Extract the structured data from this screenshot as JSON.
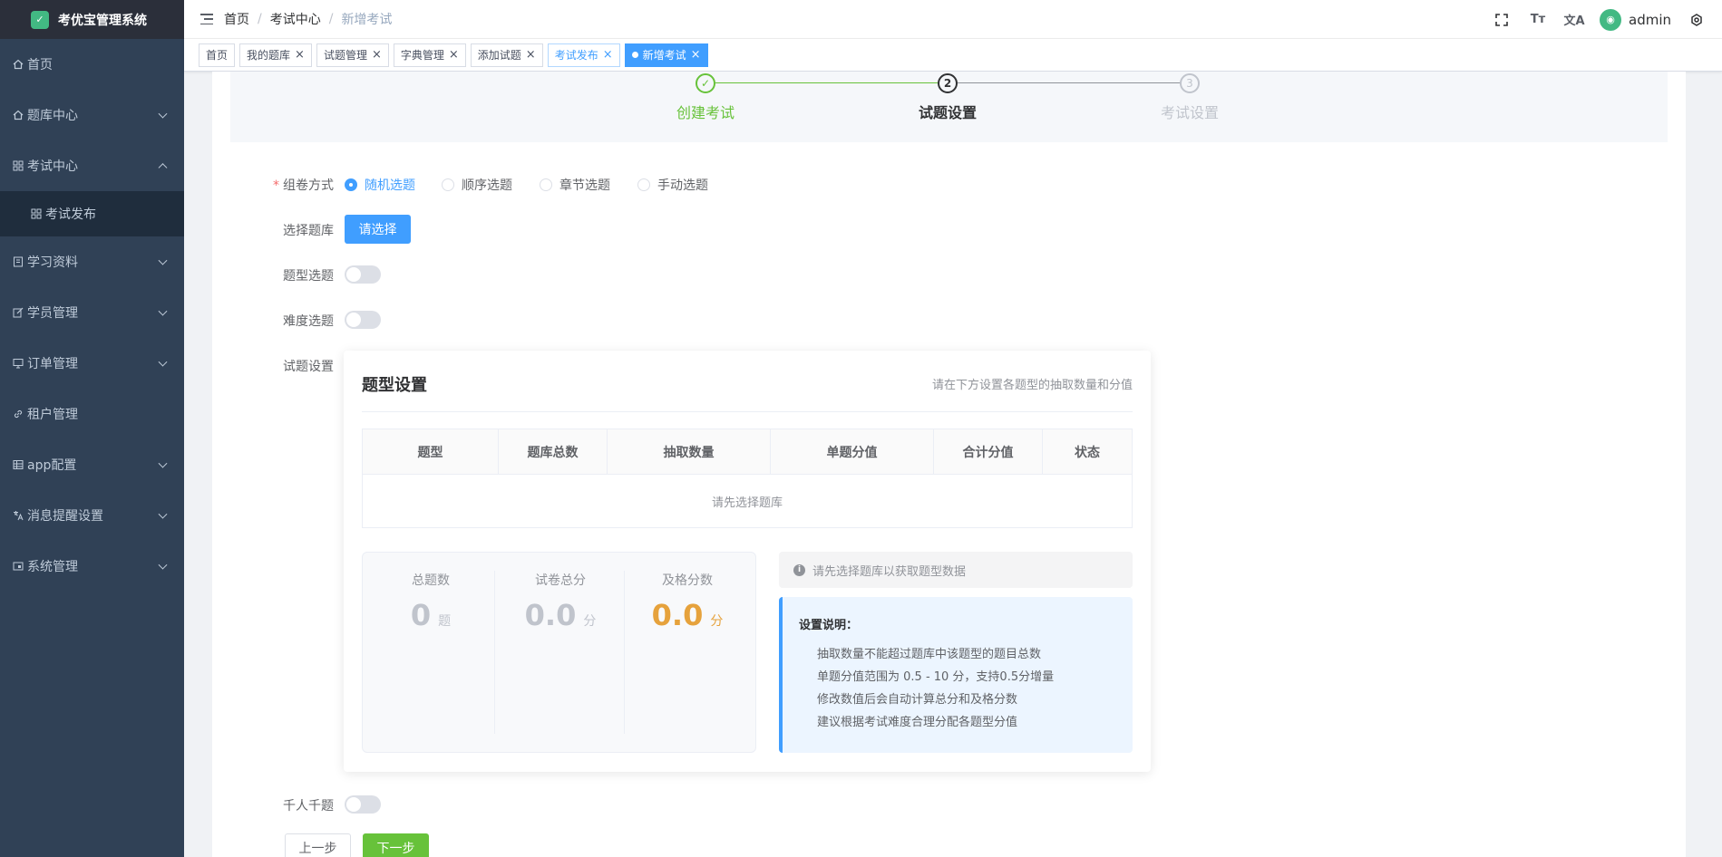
{
  "app": {
    "title": "考优宝管理系统",
    "logo_glyph": "✓"
  },
  "sidebar": {
    "items": [
      {
        "label": "首页",
        "icon": "home-icon"
      },
      {
        "label": "题库中心",
        "icon": "home-icon"
      },
      {
        "label": "考试中心",
        "icon": "grid-icon"
      },
      {
        "label": "考试发布",
        "icon": "grid-icon"
      },
      {
        "label": "学习资料",
        "icon": "book-icon"
      },
      {
        "label": "学员管理",
        "icon": "edit-icon"
      },
      {
        "label": "订单管理",
        "icon": "monitor-icon"
      },
      {
        "label": "租户管理",
        "icon": "link-icon"
      },
      {
        "label": "app配置",
        "icon": "table-icon"
      },
      {
        "label": "消息提醒设置",
        "icon": "language-icon"
      },
      {
        "label": "系统管理",
        "icon": "system-icon"
      }
    ]
  },
  "navbar": {
    "breadcrumb": [
      "首页",
      "考试中心",
      "新增考试"
    ],
    "sep": "/",
    "user": "admin",
    "icons": {
      "size": "Tт",
      "lang": "文A"
    }
  },
  "tags": [
    {
      "label": "首页"
    },
    {
      "label": "我的题库"
    },
    {
      "label": "试题管理"
    },
    {
      "label": "字典管理"
    },
    {
      "label": "添加试题"
    },
    {
      "label": "考试发布"
    },
    {
      "label": "新增考试"
    }
  ],
  "close_glyph": "×",
  "steps": [
    {
      "title": "创建考试",
      "status": "finish",
      "num": "✓"
    },
    {
      "title": "试题设置",
      "status": "process",
      "num": "2"
    },
    {
      "title": "考试设置",
      "status": "wait",
      "num": "3"
    }
  ],
  "form": {
    "compose_label": "组卷方式",
    "required_mark": "*",
    "compose_options": [
      "随机选题",
      "顺序选题",
      "章节选题",
      "手动选题"
    ],
    "compose_selected": "随机选题",
    "bank_label": "选择题库",
    "bank_button": "请选择",
    "type_label": "题型选题",
    "type_on": false,
    "difficulty_label": "难度选题",
    "difficulty_on": false,
    "question_label": "试题设置",
    "unique_label": "千人千题",
    "unique_on": false,
    "prev_button": "上一步",
    "next_button": "下一步"
  },
  "card": {
    "title": "题型设置",
    "hint": "请在下方设置各题型的抽取数量和分值",
    "columns": [
      "题型",
      "题库总数",
      "抽取数量",
      "单题分值",
      "合计分值",
      "状态"
    ],
    "empty": "请先选择题库",
    "stats": [
      {
        "label": "总题数",
        "value": "0",
        "unit": "题"
      },
      {
        "label": "试卷总分",
        "value": "0.0",
        "unit": "分"
      },
      {
        "label": "及格分数",
        "value": "0.0",
        "unit": "分"
      }
    ],
    "alert": "请先选择题库以获取题型数据",
    "alert_icon": "i",
    "note_title": "设置说明：",
    "notes": [
      "抽取数量不能超过题库中该题型的题目总数",
      "单题分值范围为 0.5 - 10 分，支持0.5分增量",
      "修改数值后会自动计算总分和及格分数",
      "建议根据考试难度合理分配各题型分值"
    ]
  },
  "colors": {
    "primary": "#409eff",
    "success": "#67c23a",
    "warning": "#e6a23c",
    "sidebar": "#304156"
  }
}
